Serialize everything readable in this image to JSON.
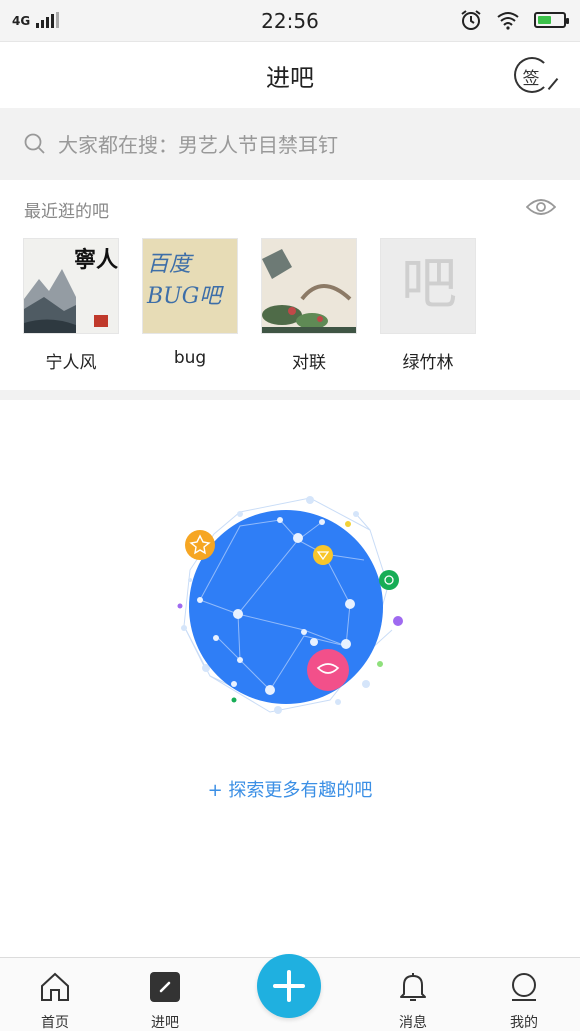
{
  "status_bar": {
    "network": "4G",
    "time": "22:56",
    "icons": [
      "signal-icon",
      "alarm-icon",
      "wifi-icon",
      "battery-icon"
    ],
    "battery_color": "#3cc24a"
  },
  "header": {
    "title": "进吧",
    "sign_label": "签"
  },
  "search": {
    "placeholder": "大家都在搜：男艺人节目禁耳钉"
  },
  "recent": {
    "title": "最近逛的吧",
    "items": [
      {
        "name": "宁人风",
        "thumb_text": "寧人"
      },
      {
        "name": "bug",
        "thumb_text": "百度 BUG吧"
      },
      {
        "name": "对联",
        "thumb_text": ""
      },
      {
        "name": "绿竹林",
        "thumb_text": "吧"
      }
    ]
  },
  "explore": {
    "link_label": "+ 探索更多有趣的吧",
    "accent": "#2f7ef6"
  },
  "bottom_nav": {
    "items": [
      {
        "label": "首页",
        "icon": "home-icon"
      },
      {
        "label": "进吧",
        "icon": "enter-bar-icon"
      },
      {
        "label": "",
        "icon": "plus-icon"
      },
      {
        "label": "消息",
        "icon": "bell-icon"
      },
      {
        "label": "我的",
        "icon": "profile-icon"
      }
    ],
    "add_color": "#1fb0e0"
  }
}
